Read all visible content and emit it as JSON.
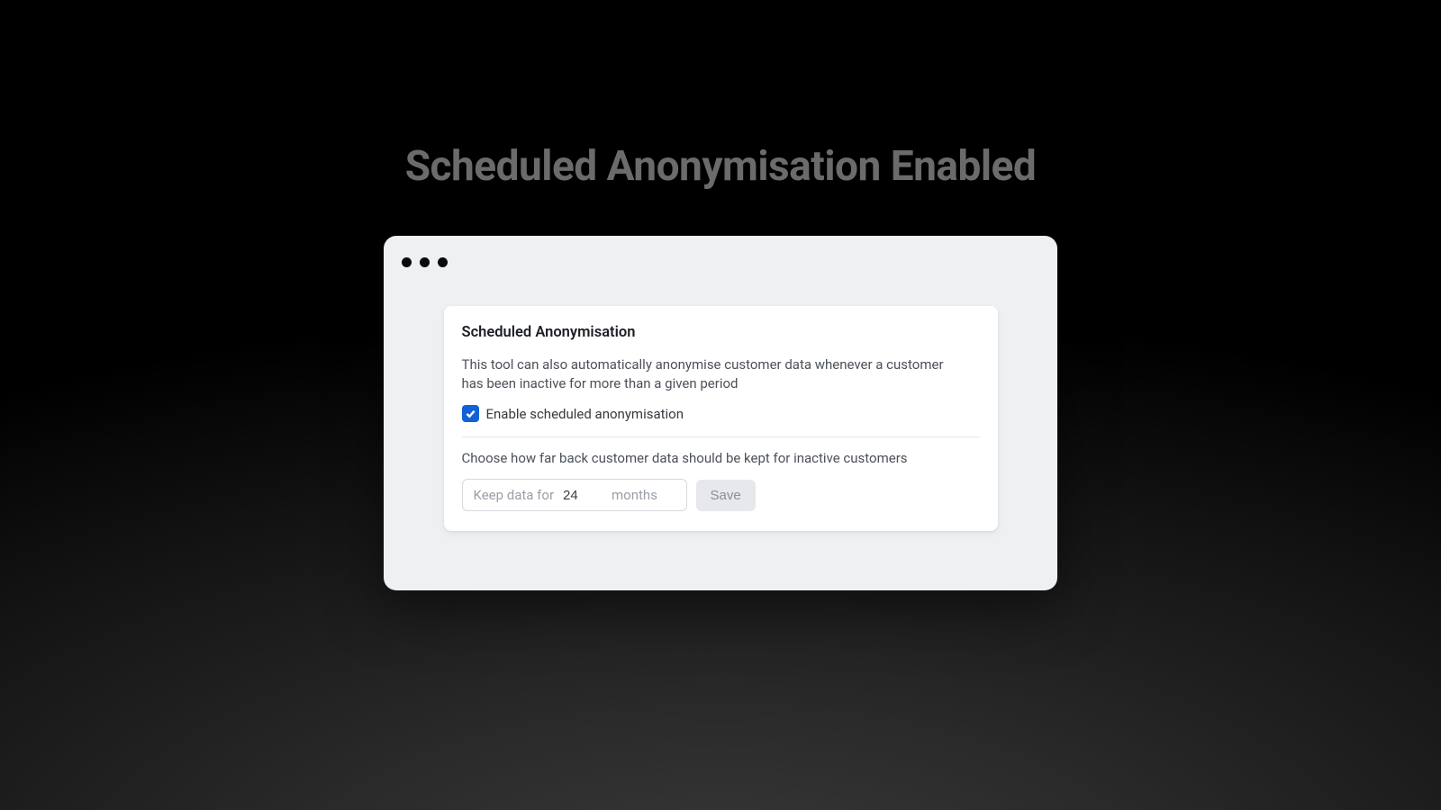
{
  "page": {
    "title": "Scheduled Anonymisation Enabled"
  },
  "card": {
    "title": "Scheduled Anonymisation",
    "description": "This tool can also automatically anonymise customer data whenever a customer has been inactive for more than a given period",
    "checkbox_label": "Enable scheduled anonymisation",
    "checkbox_checked": true,
    "retention": {
      "description": "Choose how far back customer data should be kept for inactive customers",
      "prefix": "Keep data for",
      "value": "24",
      "suffix": "months",
      "save_label": "Save"
    }
  }
}
